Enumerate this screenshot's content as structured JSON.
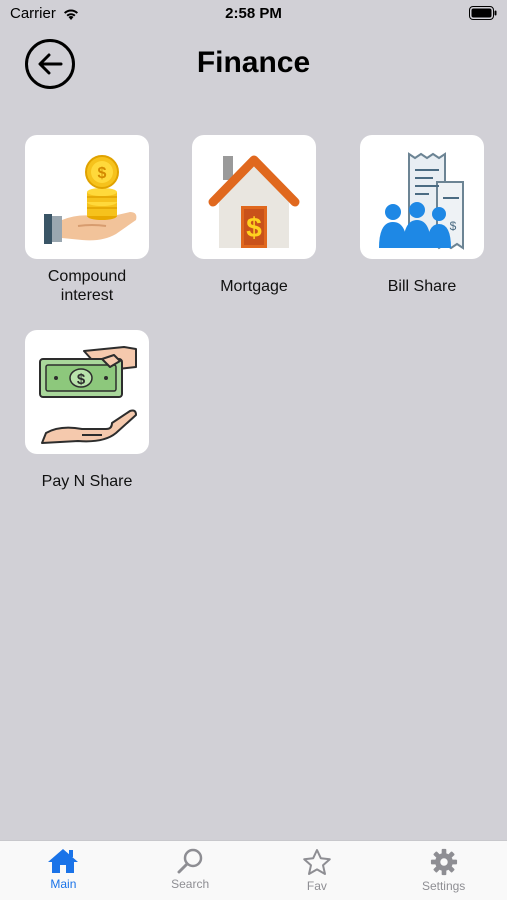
{
  "status_bar": {
    "carrier": "Carrier",
    "time": "2:58 PM"
  },
  "header": {
    "title": "Finance",
    "back_icon": "arrow-left-circle-icon"
  },
  "tiles": [
    {
      "label": "Compound\ninterest",
      "icon": "coins-in-hand-icon"
    },
    {
      "label": "Mortgage",
      "icon": "house-dollar-icon"
    },
    {
      "label": "Bill Share",
      "icon": "receipt-people-icon"
    },
    {
      "label": "Pay N Share",
      "icon": "cash-handover-icon"
    }
  ],
  "tab_bar": {
    "active_color": "#1a73e8",
    "inactive_color": "#8e8e93",
    "tabs": [
      {
        "label": "Main",
        "icon": "home-icon",
        "active": true
      },
      {
        "label": "Search",
        "icon": "search-icon",
        "active": false
      },
      {
        "label": "Fav",
        "icon": "star-icon",
        "active": false
      },
      {
        "label": "Settings",
        "icon": "gear-icon",
        "active": false
      }
    ]
  }
}
